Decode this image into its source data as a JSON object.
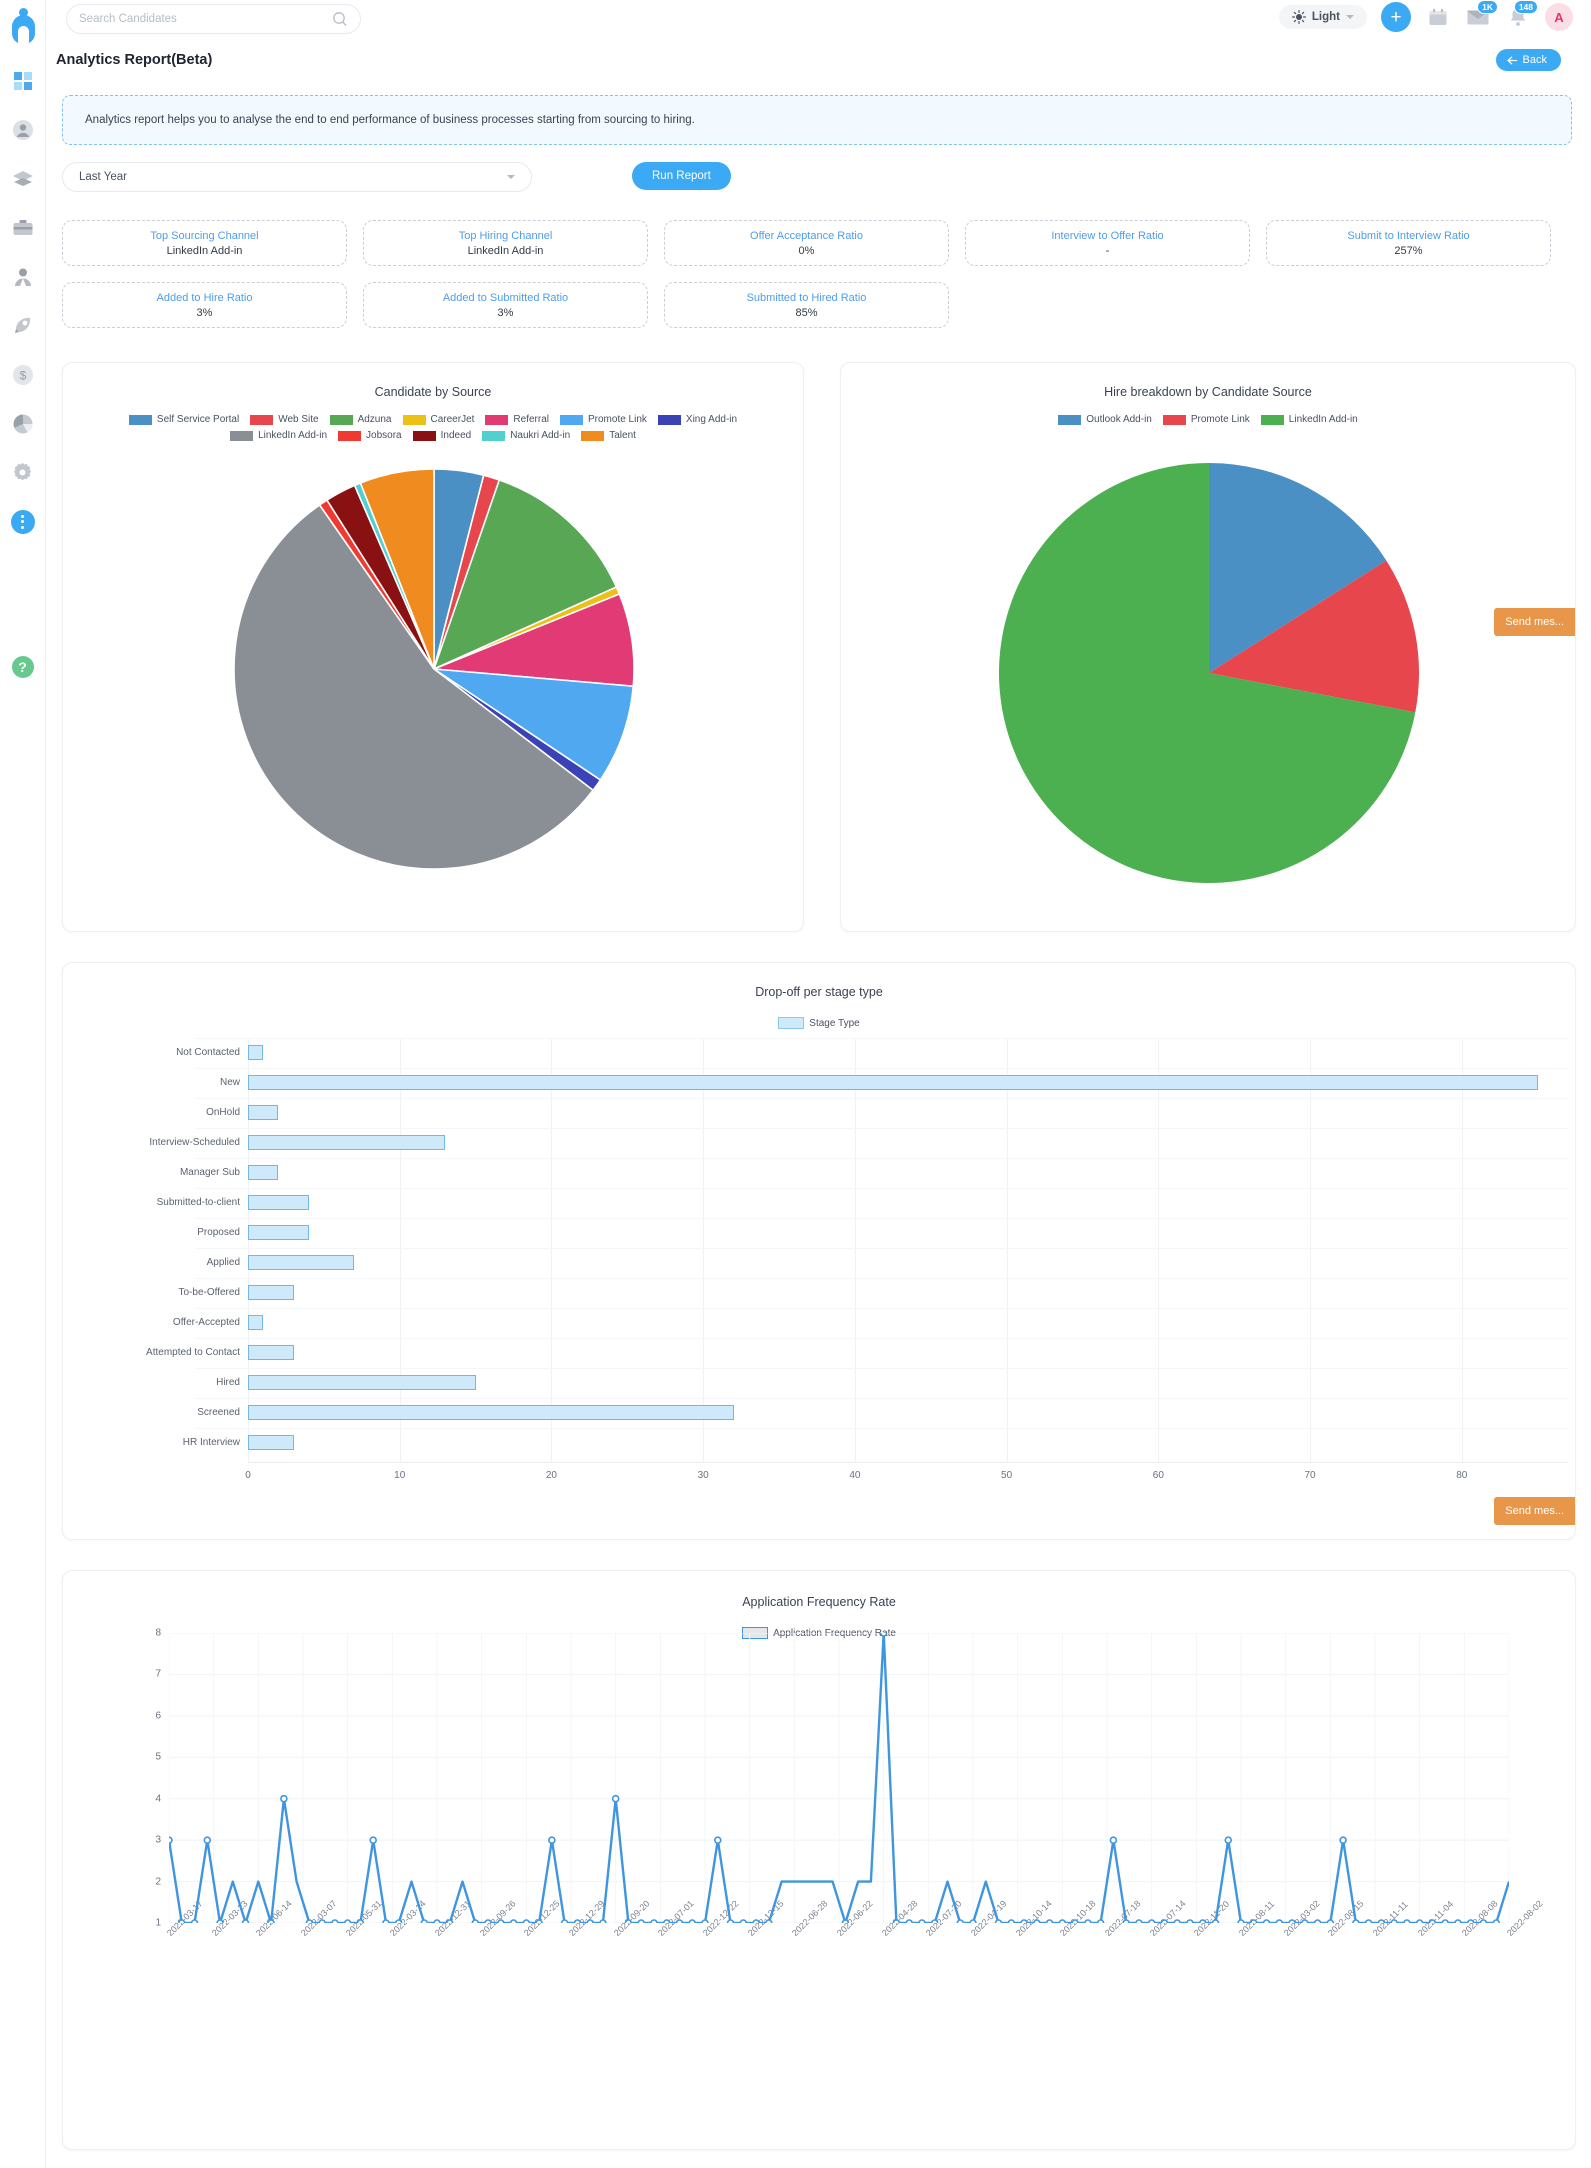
{
  "app": {
    "logo_name": "company-logo"
  },
  "search": {
    "placeholder": "Search Candidates",
    "value": ""
  },
  "header": {
    "theme_label": "Light",
    "plus_label": "+",
    "mail_badge": "1K",
    "bell_badge": "148",
    "avatar_initial": "A"
  },
  "page": {
    "title": "Analytics Report(Beta)",
    "back_label": "Back",
    "info_text": "Analytics report helps you to analyse the end to end performance of business processes starting from sourcing to hiring."
  },
  "filters": {
    "period_value": "Last Year",
    "run_label": "Run Report"
  },
  "kpis": [
    {
      "label": "Top Sourcing Channel",
      "value": "LinkedIn Add-in"
    },
    {
      "label": "Top Hiring Channel",
      "value": "LinkedIn Add-in"
    },
    {
      "label": "Offer Acceptance Ratio",
      "value": "0%"
    },
    {
      "label": "Interview to Offer Ratio",
      "value": "-"
    },
    {
      "label": "Submit to Interview Ratio",
      "value": "257%"
    },
    {
      "label": "Added to Hire Ratio",
      "value": "3%"
    },
    {
      "label": "Added to Submitted Ratio",
      "value": "3%"
    },
    {
      "label": "Submitted to Hired Ratio",
      "value": "85%"
    }
  ],
  "send_message_tab": "Send mes...",
  "sidebar": {
    "items": [
      {
        "name": "dashboard",
        "icon": "grid-icon"
      },
      {
        "name": "contacts",
        "icon": "person-circle-icon"
      },
      {
        "name": "layers",
        "icon": "layers-icon"
      },
      {
        "name": "jobs",
        "icon": "briefcase-icon"
      },
      {
        "name": "candidates",
        "icon": "user-icon"
      },
      {
        "name": "campaigns",
        "icon": "rocket-icon"
      },
      {
        "name": "billing",
        "icon": "dollar-icon"
      },
      {
        "name": "analytics",
        "icon": "pie-chart-icon"
      },
      {
        "name": "settings",
        "icon": "gear-icon"
      },
      {
        "name": "more",
        "icon": "vertical-dots-icon"
      }
    ],
    "help_label": "?"
  },
  "chart_data": [
    {
      "type": "pie",
      "title": "Candidate by Source",
      "legend_position": "top",
      "labels": [
        "Self Service Portal",
        "Web Site",
        "Adzuna",
        "CareerJet",
        "Referral",
        "Promote Link",
        "Xing Add-in",
        "LinkedIn Add-in",
        "Jobsora",
        "Indeed",
        "Naukri Add-in",
        "Talent"
      ],
      "colors": [
        "#4a90c4",
        "#e8464d",
        "#57a755",
        "#edc015",
        "#e13a74",
        "#4fa8f0",
        "#3b42b5",
        "#8a8f96",
        "#ef3a32",
        "#8a1111",
        "#52cfcf",
        "#ef8b1f"
      ],
      "values": [
        4.0,
        1.3,
        13.0,
        0.6,
        7.5,
        8.0,
        1.0,
        55.0,
        0.7,
        2.5,
        0.5,
        6.0
      ]
    },
    {
      "type": "pie",
      "title": "Hire breakdown by Candidate Source",
      "legend_position": "top",
      "labels": [
        "Outlook Add-in",
        "Promote Link",
        "LinkedIn Add-in"
      ],
      "colors": [
        "#4a90c4",
        "#e8464d",
        "#4caf50"
      ],
      "values": [
        16.0,
        12.0,
        72.0
      ]
    },
    {
      "type": "bar",
      "orientation": "horizontal",
      "title": "Drop-off per stage type",
      "legend": [
        "Stage Type"
      ],
      "legend_color": "#cde9fa",
      "xlabel": "",
      "ylabel": "",
      "xlim": [
        0,
        87
      ],
      "xticks": [
        0,
        10,
        20,
        30,
        40,
        50,
        60,
        70,
        80
      ],
      "categories": [
        "Not Contacted",
        "New",
        "OnHold",
        "Interview-Scheduled",
        "Manager Sub",
        "Submitted-to-client",
        "Proposed",
        "Applied",
        "To-be-Offered",
        "Offer-Accepted",
        "Attempted to Contact",
        "Hired",
        "Screened",
        "HR Interview"
      ],
      "values": [
        1,
        85,
        2,
        13,
        2,
        4,
        4,
        7,
        3,
        1,
        3,
        15,
        32,
        3
      ]
    },
    {
      "type": "line",
      "title": "Application Frequency Rate",
      "legend": [
        "Application Frequency Rate"
      ],
      "legend_color": "#e4e6e9",
      "line_color": "#3f95e0",
      "ylim": [
        1,
        8
      ],
      "yticks": [
        1,
        2,
        3,
        4,
        5,
        6,
        7,
        8
      ],
      "x_tick_labels": [
        "2022-03-17",
        "2022-03-23",
        "2022-06-14",
        "2022-03-07",
        "2022-05-31",
        "2022-03-14",
        "2022-12-31",
        "2022-09-26",
        "2022-12-25",
        "2022-12-29",
        "2022-09-20",
        "2022-07-01",
        "2022-12-22",
        "2022-12-15",
        "2022-06-28",
        "2022-06-22",
        "2022-04-28",
        "2022-07-20",
        "2022-04-19",
        "2022-10-14",
        "2022-10-18",
        "2022-07-18",
        "2022-07-14",
        "2022-11-20",
        "2022-08-11",
        "2022-03-02",
        "2022-08-15",
        "2022-11-11",
        "2022-11-04",
        "2022-08-08",
        "2022-08-02"
      ],
      "values": [
        3,
        1,
        1,
        3,
        1,
        2,
        1,
        2,
        1,
        4,
        2,
        1,
        1,
        1,
        1,
        1,
        3,
        1,
        1,
        2,
        1,
        1,
        1,
        2,
        1,
        1,
        1,
        1,
        1,
        1,
        3,
        1,
        1,
        1,
        1,
        4,
        1,
        1,
        1,
        1,
        1,
        1,
        1,
        3,
        1,
        1,
        1,
        1,
        2,
        2,
        2,
        2,
        2,
        1,
        2,
        2,
        8,
        1,
        1,
        1,
        1,
        2,
        1,
        1,
        2,
        1,
        1,
        1,
        1,
        1,
        1,
        1,
        1,
        1,
        3,
        1,
        1,
        1,
        1,
        1,
        1,
        1,
        1,
        3,
        1,
        1,
        1,
        1,
        1,
        1,
        1,
        1,
        3,
        1,
        1,
        1,
        1,
        1,
        1,
        1,
        1,
        1,
        1,
        1,
        1,
        2
      ]
    }
  ]
}
